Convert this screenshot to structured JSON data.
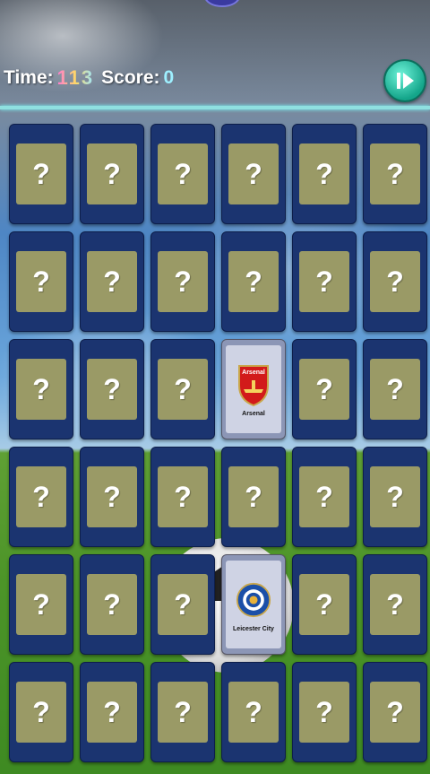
{
  "hud": {
    "time_label": "Time:",
    "time_value": "113",
    "score_label": "Score:",
    "score_value": "0"
  },
  "buttons": {
    "play_icon": "play-pause-icon"
  },
  "grid": {
    "rows": 6,
    "cols": 6,
    "hidden_symbol": "?",
    "revealed": [
      {
        "row": 2,
        "col": 3,
        "label": "Arsenal",
        "crest_text": "Arsenal"
      },
      {
        "row": 4,
        "col": 3,
        "label": "Leicester City",
        "crest_text": ""
      }
    ]
  },
  "colors": {
    "card_back": "#1b3470",
    "card_inner": "#9a9a66",
    "play_button": "#14a58a",
    "divider": "#8fe0e0"
  }
}
